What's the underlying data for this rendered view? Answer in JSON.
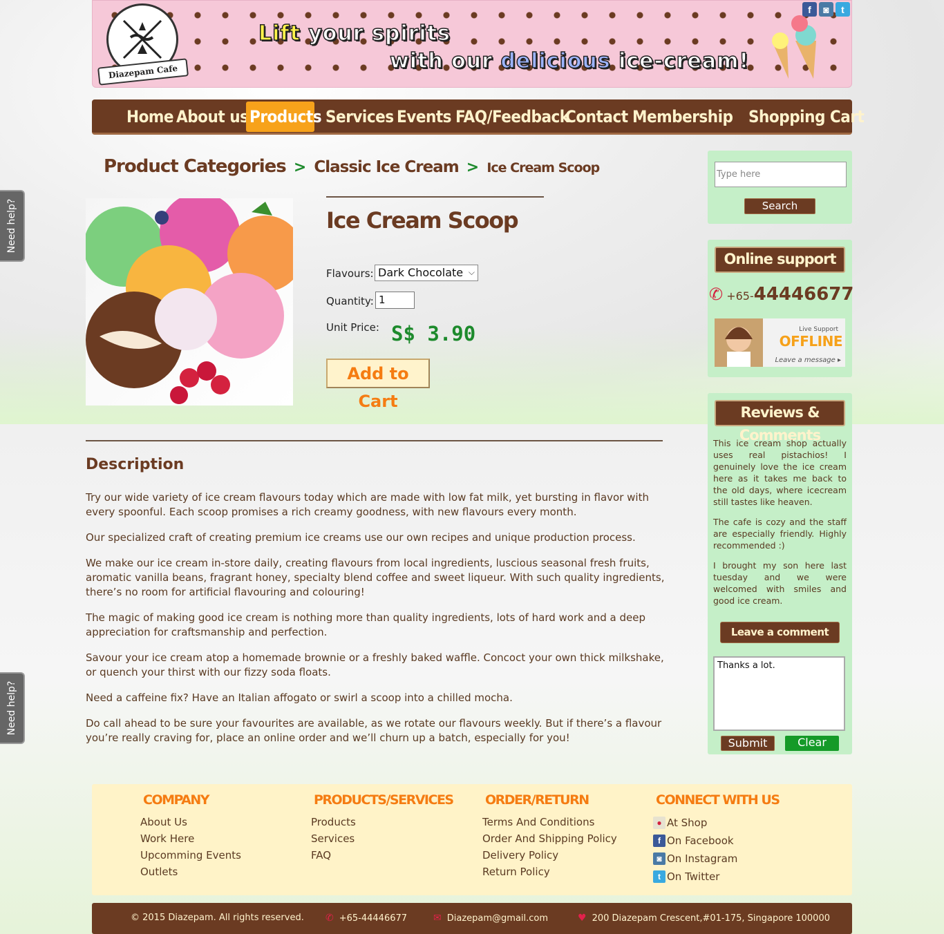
{
  "banner": {
    "logo_text": "Diazepam Cafe",
    "line1_a": "Lift",
    "line1_b": "your spirits",
    "line2_a": "with our",
    "line2_b": "delicious",
    "line2_c": "ice-cream!",
    "social": [
      "f",
      "ig",
      "t"
    ]
  },
  "nav": {
    "items": [
      "Home",
      "About us",
      "Products",
      "Services",
      "Events",
      "FAQ/Feedback",
      "Contact",
      "Membership",
      "Shopping Cart"
    ],
    "active": "Products"
  },
  "breadcrumb": {
    "level1": "Product Categories",
    "separator": ">",
    "level2": "Classic Ice Cream",
    "level3": "Ice Cream Scoop"
  },
  "product": {
    "title": "Ice Cream Scoop",
    "flavours_label": "Flavours:",
    "flavour_selected": "Dark Chocolate",
    "quantity_label": "Quantity:",
    "quantity_value": "1",
    "unit_price_label": "Unit Price:",
    "price": "S$ 3.90",
    "add_to_cart": "Add to Cart"
  },
  "description": {
    "title": "Description",
    "paragraphs": [
      "Try our wide variety of ice cream flavours today which are made with low fat milk, yet bursting in flavor with every spoonful. Each scoop promises a rich creamy goodness, with new flavours every month.",
      "Our specialized craft of creating premium ice creams use our own recipes and unique production process.",
      "We make our ice cream in-store daily, creating flavours from local ingredients, luscious seasonal fresh fruits, aromatic vanilla beans, fragrant honey, specialty blend coffee and sweet liqueur. With such quality ingredients, there’s no room for artificial flavouring and colouring!",
      "The magic of making good ice cream is nothing more than quality ingredients, lots of hard work and a deep appreciation for craftsmanship and perfection.",
      "Savour your ice cream atop a homemade brownie or a freshly baked waffle. Concoct your own thick milkshake, or quench your thirst with our fizzy soda floats.",
      "Need a caffeine fix? Have an Italian affogato or swirl a scoop into a chilled mocha.",
      "Do call ahead to be sure your favourites are available, as we rotate our flavours weekly. But if there’s a flavour you’re really craving for, place an online order and we’ll churn up a batch, especially for you!"
    ]
  },
  "sidebar": {
    "search_placeholder": "Type here",
    "search_button": "Search",
    "support_title": "Online support",
    "phone_prefix": "+65-",
    "phone_number": "44446677",
    "offline_small": "Live Support",
    "offline_big": "OFFLINE",
    "offline_leave": "Leave a message ▸",
    "reviews_title": "Reviews & Comments",
    "reviews": [
      "This ice cream shop actually uses real pistachios! I genuinely love the ice cream here as it takes me back to the old days, where icecream still tastes like heaven.",
      "The cafe is cozy and the staff are especially friendly. Highly recommended :)",
      "I brought my son here last tuesday and we were welcomed with smiles and good ice cream."
    ],
    "leave_comment": "Leave a comment",
    "comment_value": "Thanks a lot.",
    "submit": "Submit",
    "clear": "Clear"
  },
  "need_help": "Need help?",
  "footer": {
    "company_head": "COMPANY",
    "company_links": [
      "About Us",
      "Work Here",
      "Upcomming Events",
      "Outlets"
    ],
    "products_head": "PRODUCTS/SERVICES",
    "products_links": [
      "Products",
      "Services",
      "FAQ"
    ],
    "order_head": "ORDER/RETURN",
    "order_links": [
      "Terms And Conditions",
      "Order And Shipping Policy",
      "Delivery Policy",
      "Return Policy"
    ],
    "connect_head": "CONNECT WITH US",
    "connect_links": [
      "At Shop",
      "On Facebook",
      "On Instagram",
      "On Twitter"
    ]
  },
  "bottom_bar": {
    "copyright": "© 2015 Diazepam. All rights reserved.",
    "phone": "+65-44446677",
    "email": "Diazepam@gmail.com",
    "address": "200 Diazepam Crescent,#01-175, Singapore 100000"
  },
  "colors": {
    "brown": "#6b3b22",
    "orange": "#f7a21b",
    "green_price": "#1d8a2c",
    "sidebar_bg": "#c5efc8",
    "footer_bg": "#fff3c8"
  }
}
